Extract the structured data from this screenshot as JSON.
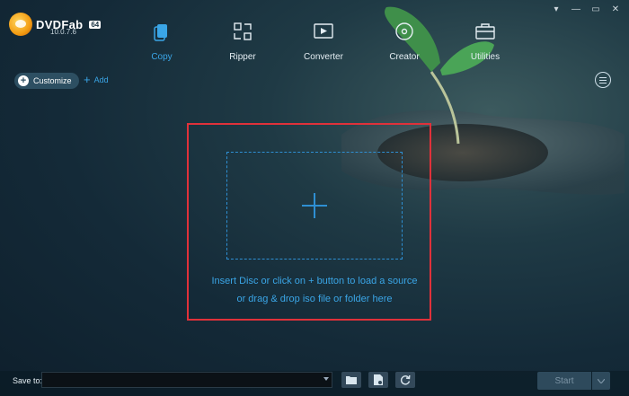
{
  "app": {
    "brand": "DVDFab",
    "badge": "64",
    "version": "10.0.7.6"
  },
  "window_controls": [
    "pin-icon",
    "minimize-icon",
    "maximize-icon",
    "close-icon"
  ],
  "modules": [
    {
      "label": "Copy",
      "icon": "copy-icon",
      "active": true
    },
    {
      "label": "Ripper",
      "icon": "ripper-icon",
      "active": false
    },
    {
      "label": "Converter",
      "icon": "converter-icon",
      "active": false
    },
    {
      "label": "Creator",
      "icon": "creator-icon",
      "active": false
    },
    {
      "label": "Utilities",
      "icon": "utilities-icon",
      "active": false
    }
  ],
  "toolbar": {
    "customize_label": "Customize",
    "add_label": "Add"
  },
  "drop_zone": {
    "hint_line1": "Insert Disc or click on + button to load a source",
    "hint_line2": "or drag & drop iso file or folder here"
  },
  "bottom": {
    "save_label": "Save to:",
    "save_value": "",
    "start_label": "Start"
  },
  "colors": {
    "accent": "#3aa5e6",
    "highlight": "#e0313a",
    "background": "#142a38"
  }
}
